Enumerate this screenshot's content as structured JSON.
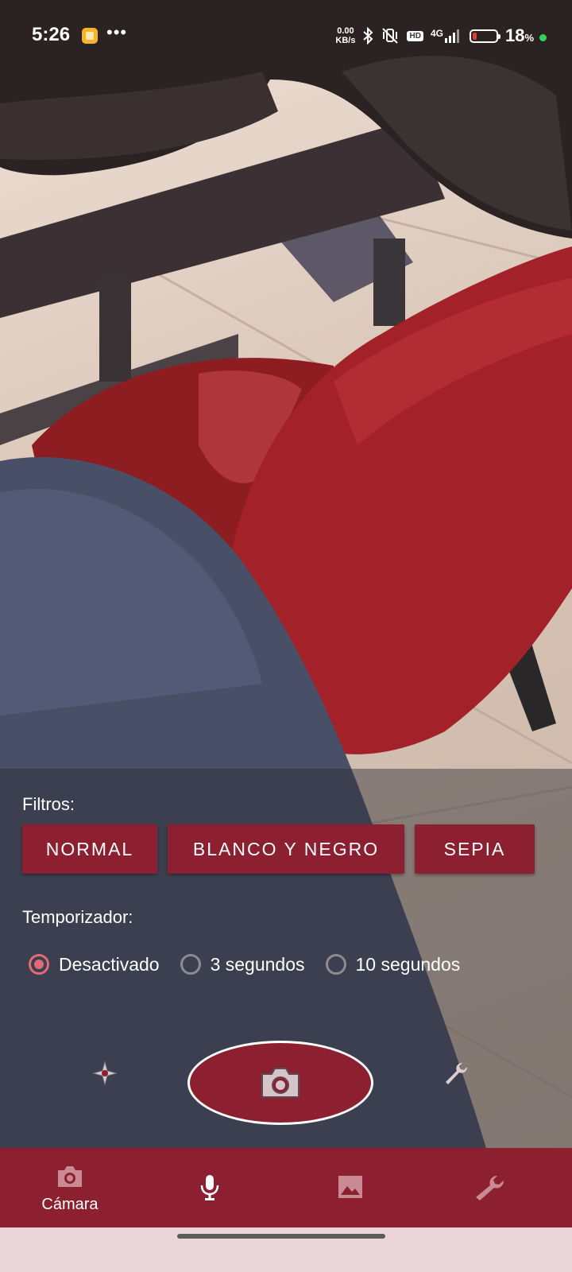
{
  "status_bar": {
    "time": "5:26",
    "net_speed_value": "0.00",
    "net_speed_unit": "KB/s",
    "hd_badge": "HD",
    "network_type": "4G",
    "battery_percent": "18",
    "battery_percent_sign": "%",
    "battery_level": 0.18,
    "more_indicator": "•••"
  },
  "controls": {
    "filters_label": "Filtros:",
    "filter_buttons": [
      {
        "label": "NORMAL"
      },
      {
        "label": "BLANCO Y NEGRO"
      },
      {
        "label": "SEPIA"
      }
    ],
    "timer_label": "Temporizador:",
    "timer_options": [
      {
        "label": "Desactivado",
        "selected": true
      },
      {
        "label": "3 segundos",
        "selected": false
      },
      {
        "label": "10 segundos",
        "selected": false
      }
    ],
    "left_icon": "compass-icon",
    "right_icon": "wrench-icon",
    "shutter_icon": "camera-icon"
  },
  "bottom_nav": {
    "items": [
      {
        "label": "Cámara",
        "icon": "camera-icon",
        "active": true
      },
      {
        "label": "",
        "icon": "microphone-icon",
        "active": false
      },
      {
        "label": "",
        "icon": "image-icon",
        "active": false
      },
      {
        "label": "",
        "icon": "wrench-icon",
        "active": false
      }
    ]
  },
  "colors": {
    "accent": "#8d2030",
    "radio_checked": "#e46a74",
    "nav_background": "#8d2030",
    "gesture_bar_background": "#ead5d8"
  }
}
